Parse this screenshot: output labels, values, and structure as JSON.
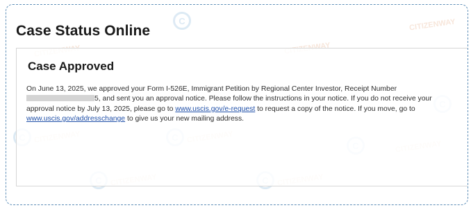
{
  "page": {
    "title": "Case Status Online"
  },
  "case": {
    "status_heading": "Case Approved",
    "text_line1": "On June 13, 2025, we approved your Form I-526E, Immigrant Petition by Regional Center Investor, Receipt Number",
    "text_line2_after_redaction": "5, and sent you an approval notice. Please follow the instructions in your notice. If you do not receive your",
    "text_line3_before_link": "approval notice by July 13, 2025, please go to ",
    "request_link": "www.uscis.gov/e-request",
    "text_line3_after_link": " to request a copy of the notice. If you move, go to",
    "address_link": "www.uscis.gov/addresschange",
    "text_line4_after_link": " to give us your new mailing address."
  },
  "watermark": {
    "text": "CITIZENWAY",
    "icon": "citizenway-logo-icon"
  }
}
